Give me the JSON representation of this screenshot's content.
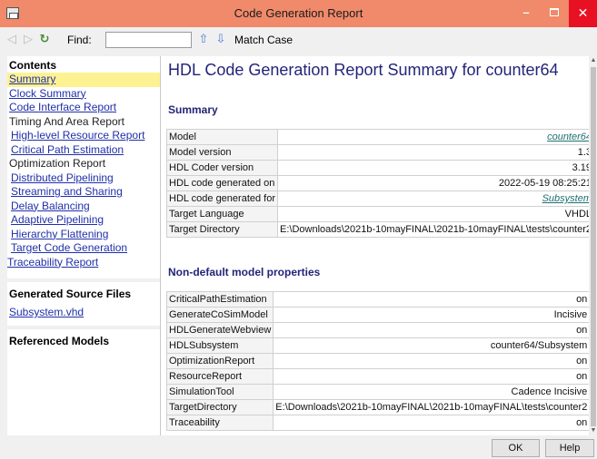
{
  "window": {
    "title": "Code Generation Report",
    "minimize_label": "–",
    "close_label": "✕"
  },
  "toolbar": {
    "back_icon": "◁",
    "forward_icon": "▷",
    "refresh_icon": "↻",
    "find_label": "Find:",
    "find_value": "",
    "find_up_icon": "⇧",
    "find_down_icon": "⇩",
    "match_case_label": "Match Case"
  },
  "nav": {
    "contents_heading": "Contents",
    "items": [
      {
        "label": "Summary"
      },
      {
        "label": "Clock Summary"
      },
      {
        "label": "Code Interface Report"
      },
      {
        "label": "Timing And Area Report"
      },
      {
        "label": "High-level Resource Report"
      },
      {
        "label": "Critical Path Estimation"
      },
      {
        "label": "Optimization Report"
      },
      {
        "label": "Distributed Pipelining"
      },
      {
        "label": "Streaming and Sharing"
      },
      {
        "label": "Delay Balancing"
      },
      {
        "label": "Adaptive Pipelining"
      },
      {
        "label": "Hierarchy Flattening"
      },
      {
        "label": "Target Code Generation"
      },
      {
        "label": "Traceability Report"
      }
    ],
    "files_heading": "Generated Source Files",
    "files": [
      {
        "label": "Subsystem.vhd"
      }
    ],
    "ref_heading": "Referenced Models"
  },
  "report": {
    "title": "HDL Code Generation Report Summary for counter64",
    "summary_heading": "Summary",
    "summary": [
      {
        "key": "Model",
        "value": "counter64"
      },
      {
        "key": "Model version",
        "value": "1.3"
      },
      {
        "key": "HDL Coder version",
        "value": "3.19"
      },
      {
        "key": "HDL code generated on",
        "value": "2022-05-19 08:25:21"
      },
      {
        "key": "HDL code generated for",
        "value": "Subsystem"
      },
      {
        "key": "Target Language",
        "value": "VHDL"
      },
      {
        "key": "Target Directory",
        "value": "E:\\Downloads\\2021b-10mayFINAL\\2021b-10mayFINAL\\tests\\counter2"
      }
    ],
    "nondefault_heading": "Non-default model properties",
    "nondefault": [
      {
        "key": "CriticalPathEstimation",
        "value": "on"
      },
      {
        "key": "GenerateCoSimModel",
        "value": "Incisive"
      },
      {
        "key": "HDLGenerateWebview",
        "value": "on"
      },
      {
        "key": "HDLSubsystem",
        "value": "counter64/Subsystem"
      },
      {
        "key": "OptimizationReport",
        "value": "on"
      },
      {
        "key": "ResourceReport",
        "value": "on"
      },
      {
        "key": "SimulationTool",
        "value": "Cadence Incisive"
      },
      {
        "key": "TargetDirectory",
        "value": "E:\\Downloads\\2021b-10mayFINAL\\2021b-10mayFINAL\\tests\\counter2"
      },
      {
        "key": "Traceability",
        "value": "on"
      }
    ]
  },
  "buttons": {
    "ok_label": "OK",
    "help_label": "Help"
  },
  "colors": {
    "titlebar": "#f08a6a",
    "close_button": "#e81123",
    "active_nav": "#fdf291",
    "link": "#1f2fa8",
    "heading": "#24247a"
  }
}
